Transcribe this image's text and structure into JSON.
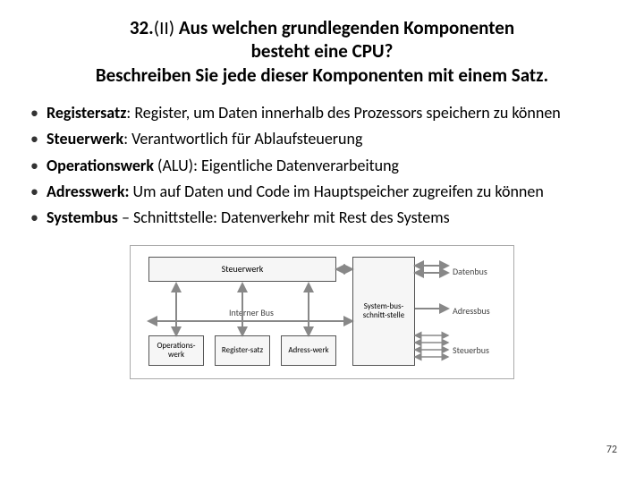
{
  "title": {
    "number": "32.",
    "tier": "(II)",
    "line1_rest": " Aus welchen grundlegenden Komponenten",
    "line2": "besteht eine CPU?",
    "line3": "Beschreiben Sie jede dieser Komponenten mit einem Satz."
  },
  "bullets": [
    {
      "term": "Registersatz",
      "sep": ": ",
      "desc": "Register, um Daten innerhalb des Prozessors speichern zu können"
    },
    {
      "term": "Steuerwerk",
      "sep": ": ",
      "desc": "Verantwortlich für Ablaufsteuerung"
    },
    {
      "term": "Operationswerk",
      "paren": " (ALU)",
      "sep": ": ",
      "desc": "Eigentliche Datenverarbeitung"
    },
    {
      "term": "Adresswerk:",
      "sep": " ",
      "desc": "Um auf Daten und Code im Hauptspeicher zugreifen zu können"
    },
    {
      "term": "Systembus",
      "sep": " – ",
      "desc": "Schnittstelle: Datenverkehr mit Rest des Systems"
    }
  ],
  "diagram": {
    "steuerwerk": "Steuerwerk",
    "interner_bus": "Interner Bus",
    "operationswerk": "Operations-werk",
    "registersatz": "Register-satz",
    "adresswerk": "Adress-werk",
    "systembus_schnittstelle": "System-bus-schnitt-stelle",
    "datenbus": "Datenbus",
    "adressbus": "Adressbus",
    "steuerbus": "Steuerbus"
  },
  "page_number": "72"
}
